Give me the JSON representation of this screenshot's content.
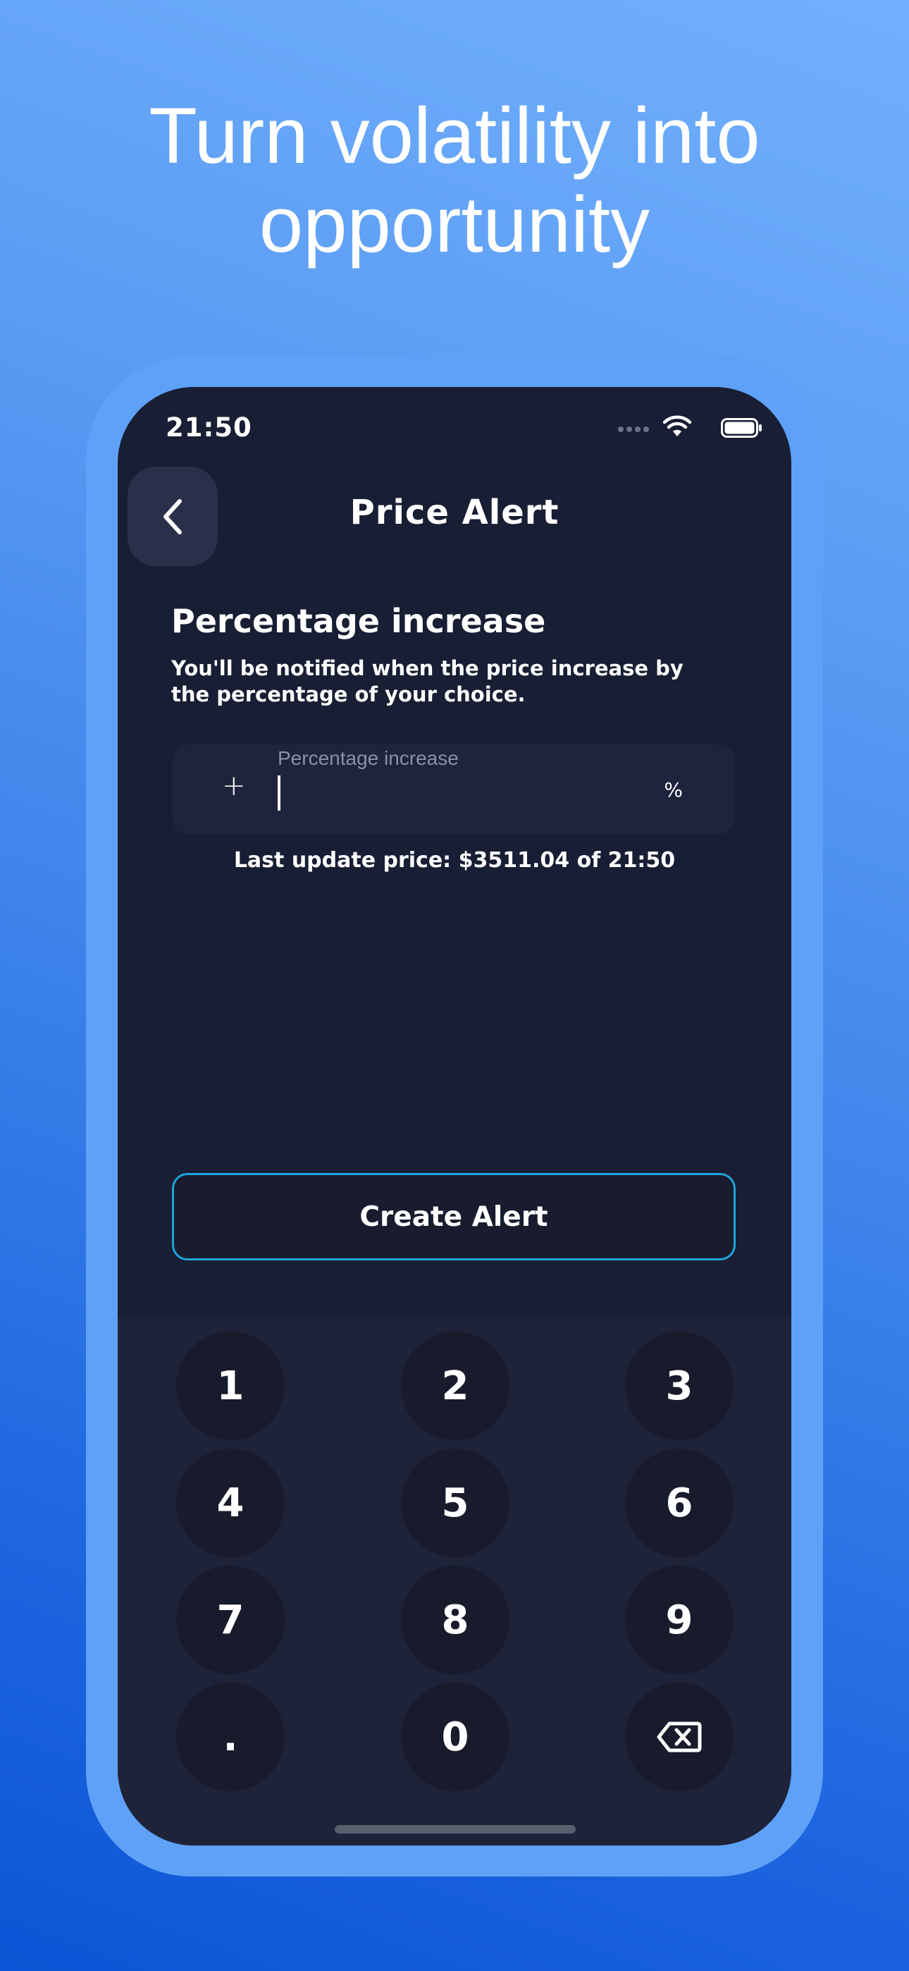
{
  "headline": {
    "line1": "Turn volatility into",
    "line2": "opportunity"
  },
  "status_bar": {
    "time": "21:50"
  },
  "nav": {
    "title": "Price Alert",
    "back_icon": "chevron-left-icon"
  },
  "alert_form": {
    "title": "Percentage increase",
    "subtitle": "You'll be notified when the price increase by the percentage of your choice.",
    "input_label": "Percentage increase",
    "input_prefix": "+",
    "input_value": "",
    "input_suffix": "%",
    "last_update": "Last update price: $3511.04 of 21:50"
  },
  "create_button": {
    "label": "Create Alert",
    "border_color": "#1fa3d8"
  },
  "keypad": {
    "keys": [
      "1",
      "2",
      "3",
      "4",
      "5",
      "6",
      "7",
      "8",
      "9",
      ".",
      "0"
    ],
    "delete_icon": "backspace-icon"
  },
  "colors": {
    "screen_bg": "#181e33",
    "keypad_bg": "#1f2339",
    "key_bg": "#171b2c",
    "accent": "#1fa3d8"
  }
}
